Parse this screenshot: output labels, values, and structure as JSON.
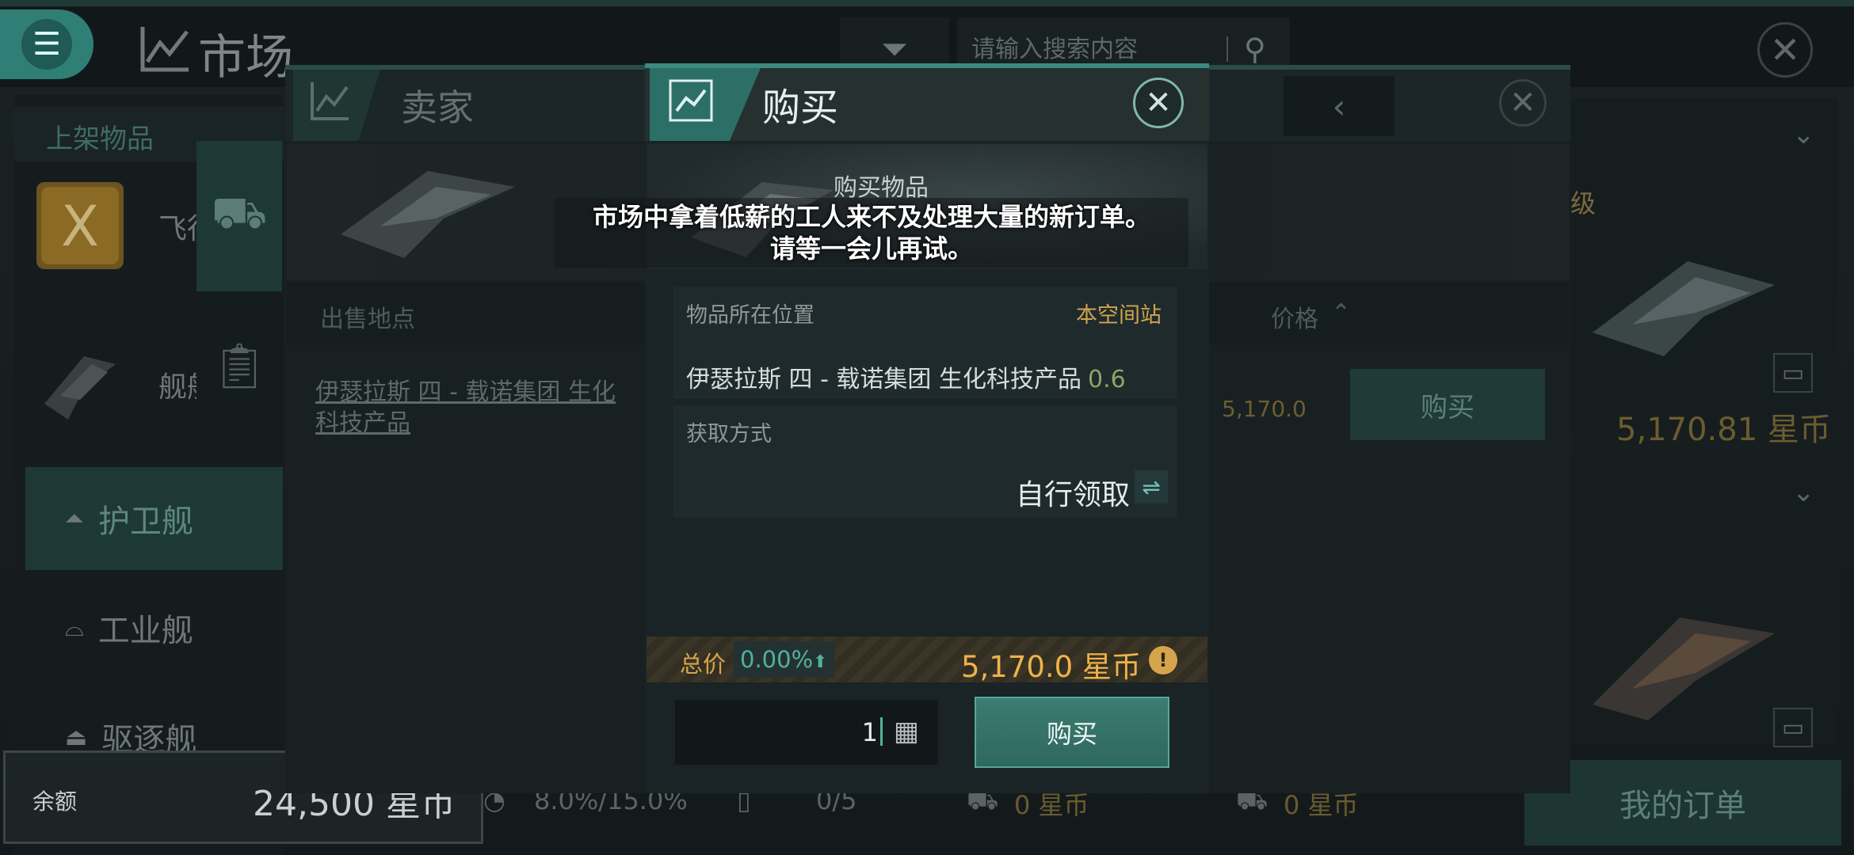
{
  "header": {
    "title": "市场",
    "search_placeholder": "请输入搜索内容"
  },
  "left_panel": {
    "section_title": "上架物品",
    "items": [
      {
        "label": "飞行"
      },
      {
        "label": "舰船"
      }
    ],
    "categories": [
      {
        "label": "护卫舰",
        "active": true
      },
      {
        "label": "工业舰",
        "active": false
      },
      {
        "label": "驱逐舰",
        "active": false
      }
    ]
  },
  "balance": {
    "label": "余额",
    "value": "24,500 星币"
  },
  "stats": {
    "tax": "8.0%/15.0%",
    "orders": "0/5",
    "escrow_a": "0 星币",
    "escrow_b": "0 星币"
  },
  "my_orders_label": "我的订单",
  "right_column": {
    "tag": "级",
    "price": "5,170.81 星币"
  },
  "seller_panel": {
    "title": "卖家",
    "col_location": "出售地点",
    "col_price": "价格",
    "row": {
      "location": "伊瑟拉斯 四 - 载诺集团 生化科技产品",
      "price": "5,170.0",
      "buy_label": "购买"
    }
  },
  "buy_dialog": {
    "title": "购买",
    "item_label": "购买物品",
    "location_label": "物品所在位置",
    "location_tag": "本空间站",
    "location_name": "伊瑟拉斯 四 - 载诺集团 生化科技产品",
    "security": "0.6",
    "acquire_label": "获取方式",
    "acquire_value": "自行领取",
    "total_label": "总价",
    "total_pct": "0.00%",
    "total_value": "5,170.0 星币",
    "quantity": "1",
    "buy_label": "购买"
  },
  "toast": {
    "line1": "市场中拿着低薪的工人来不及处理大量的新订单。",
    "line2": "请等一会儿再试。"
  },
  "colors": {
    "accent": "#2f7f76",
    "gold": "#f0b24a",
    "positive": "#4fb29f"
  }
}
